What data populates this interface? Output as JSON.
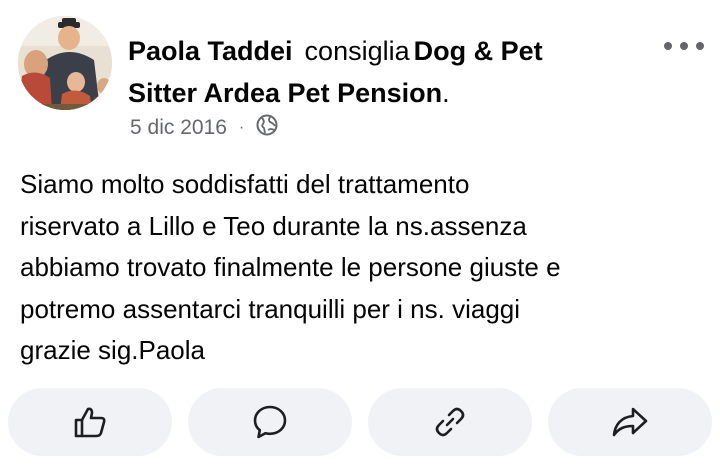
{
  "post": {
    "author": "Paola Taddei",
    "verb": "consiglia",
    "page_name": "Dog & Pet Sitter Ardea Pet Pension",
    "page_name_line1": "Dog & Pet",
    "page_name_line2": "Sitter Ardea Pet Pension",
    "page_name_suffix": ".",
    "date": "5 dic 2016",
    "separator": "·",
    "audience_icon": "globe-icon",
    "body_lines": [
      "Siamo molto soddisfatti del trattamento",
      "riservato a Lillo e Teo durante la ns.assenza",
      "abbiamo trovato finalmente le persone giuste e",
      "potremo assentarci tranquilli per i ns. viaggi",
      "grazie sig.Paola"
    ]
  },
  "actions": [
    {
      "name": "like",
      "icon": "thumbs-up-icon"
    },
    {
      "name": "comment",
      "icon": "comment-bubble-icon"
    },
    {
      "name": "copy-link",
      "icon": "link-icon"
    },
    {
      "name": "share",
      "icon": "share-arrow-icon"
    }
  ],
  "colors": {
    "text": "#050505",
    "secondary_text": "#65676b",
    "button_bg": "#f0f2f5"
  }
}
